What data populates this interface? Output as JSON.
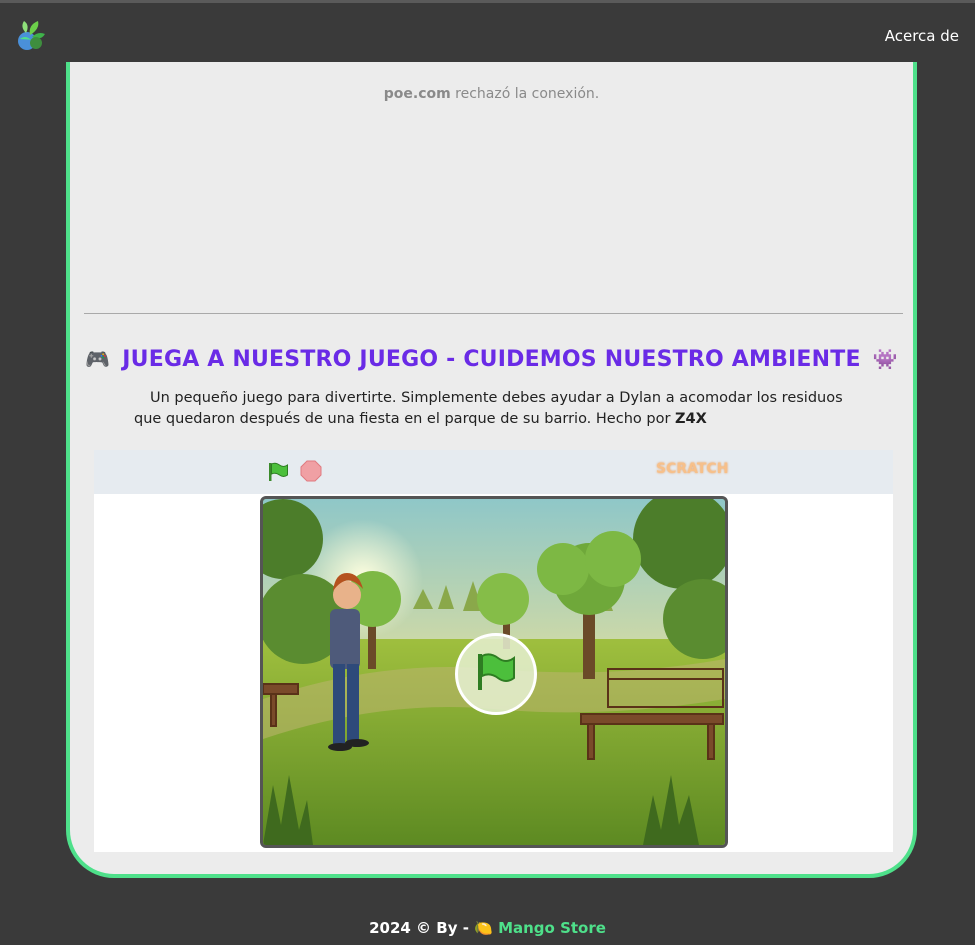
{
  "nav": {
    "about_label": "Acerca de",
    "logo_icon": "plant-globe-logo-icon"
  },
  "iframe": {
    "host": "poe.com",
    "message": " rechazó la conexión."
  },
  "game": {
    "title": "JUEGA A NUESTRO JUEGO - CUIDEMOS NUESTRO AMBIENTE",
    "title_left_icon": "🎮",
    "title_right_icon": "👾",
    "description": "Un pequeño juego para divertirte. Simplemente debes ayudar a Dylan a acomodar los residuos que quedaron después de una fiesta en el parque de su barrio. Hecho por ",
    "author": "Z4X",
    "player_logo": "SCRATCH"
  },
  "footer": {
    "prefix": "2024 © By - ",
    "brand_icon": "🍋",
    "brand": "Mango Store"
  },
  "colors": {
    "accent_green": "#4ee08a",
    "title_purple": "#6a2be6",
    "background": "#3a3a3a"
  }
}
